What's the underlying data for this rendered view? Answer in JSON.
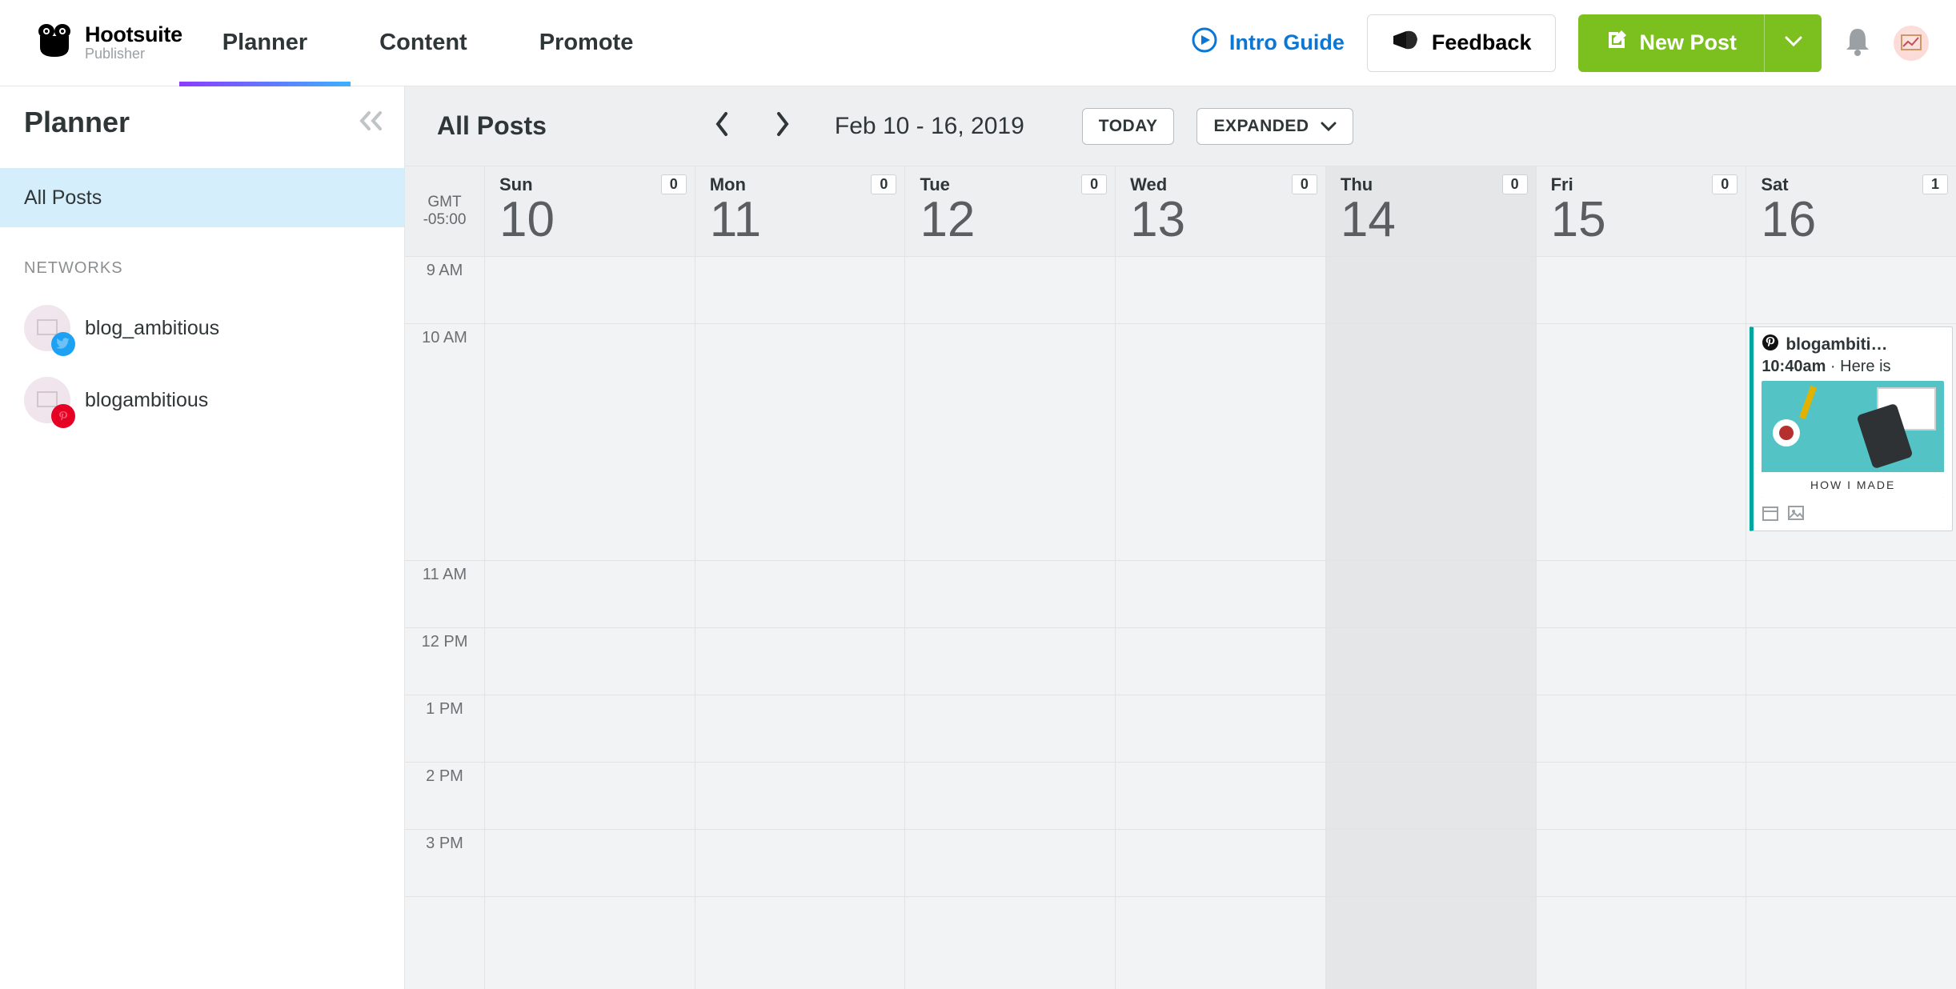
{
  "brand": {
    "title": "Hootsuite",
    "sub": "Publisher"
  },
  "nav": {
    "tabs": [
      "Planner",
      "Content",
      "Promote"
    ],
    "activeIndex": 0
  },
  "actions": {
    "intro": "Intro Guide",
    "feedback": "Feedback",
    "newpost": "New Post"
  },
  "sidebar": {
    "title": "Planner",
    "allposts": "All Posts",
    "networksLabel": "NETWORKS",
    "accounts": [
      {
        "name": "blog_ambitious",
        "network": "twitter"
      },
      {
        "name": "blogambitious",
        "network": "pinterest"
      }
    ]
  },
  "calendar": {
    "title": "All Posts",
    "range": "Feb 10 - 16, 2019",
    "todayLabel": "TODAY",
    "viewLabel": "EXPANDED",
    "timezone": {
      "l1": "GMT",
      "l2": "-05:00"
    },
    "days": [
      {
        "name": "Sun",
        "num": "10",
        "count": "0"
      },
      {
        "name": "Mon",
        "num": "11",
        "count": "0"
      },
      {
        "name": "Tue",
        "num": "12",
        "count": "0"
      },
      {
        "name": "Wed",
        "num": "13",
        "count": "0"
      },
      {
        "name": "Thu",
        "num": "14",
        "count": "0",
        "today": true
      },
      {
        "name": "Fri",
        "num": "15",
        "count": "0"
      },
      {
        "name": "Sat",
        "num": "16",
        "count": "1"
      }
    ],
    "hours": [
      "9 AM",
      "10 AM",
      "11 AM",
      "12 PM",
      "1 PM",
      "2 PM",
      "3 PM"
    ],
    "tallIndex": 1,
    "post": {
      "dayIndex": 6,
      "hourIndex": 1,
      "account": "blogambiti…",
      "time": "10:40am",
      "sep": " · ",
      "excerpt": "Here is",
      "imageCaption": "HOW I MADE"
    }
  }
}
